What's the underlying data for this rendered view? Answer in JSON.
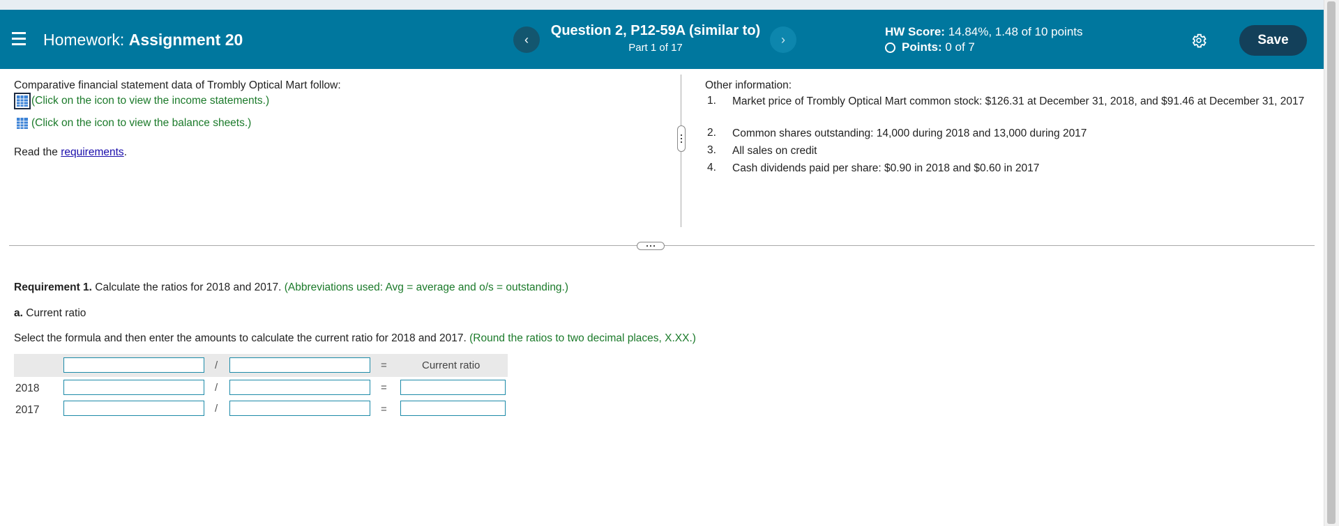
{
  "header": {
    "hw_label": "Homework:",
    "hw_name": "Assignment 20",
    "prev_icon": "‹",
    "next_icon": "›",
    "question_title": "Question 2, P12-59A (similar to)",
    "question_part": "Part 1 of 17",
    "score_label": "HW Score:",
    "score_value": "14.84%, 1.48 of 10 points",
    "points_label": "Points:",
    "points_value": "0 of 7",
    "save_label": "Save",
    "bg_color": "#00779e"
  },
  "left": {
    "intro": "Comparative financial statement data of Trombly Optical Mart follow:",
    "income_link": "(Click on the icon to view the income statements.)",
    "balance_link": "(Click on the icon to view the balance sheets.)",
    "read_prefix": "Read the ",
    "requirements_link": "requirements",
    "read_suffix": "."
  },
  "right": {
    "heading": "Other information:",
    "items": [
      {
        "num": "1.",
        "text": "Market price of Trombly Optical Mart common stock: $126.31 at December 31, 2018, and $91.46 at December 31, 2017"
      },
      {
        "num": "2.",
        "text": "Common shares outstanding: 14,000 during 2018 and 13,000 during 2017"
      },
      {
        "num": "3.",
        "text": "All sales on credit"
      },
      {
        "num": "4.",
        "text": "Cash dividends paid per share: $0.90 in 2018 and $0.60 in 2017"
      }
    ]
  },
  "requirement": {
    "title": "Requirement 1.",
    "text": " Calculate the ratios for 2018 and 2017. ",
    "note": "(Abbreviations used: Avg = average and o/s = outstanding.)",
    "part_label": "a.",
    "part_text": " Current ratio",
    "instruction": "Select the formula and then enter the amounts to calculate the current ratio for 2018 and 2017. ",
    "round_note": "(Round the ratios to two decimal places, X.XX.)"
  },
  "table": {
    "divide": "/",
    "equals": "=",
    "result_header": "Current ratio",
    "years": [
      "2018",
      "2017"
    ]
  }
}
